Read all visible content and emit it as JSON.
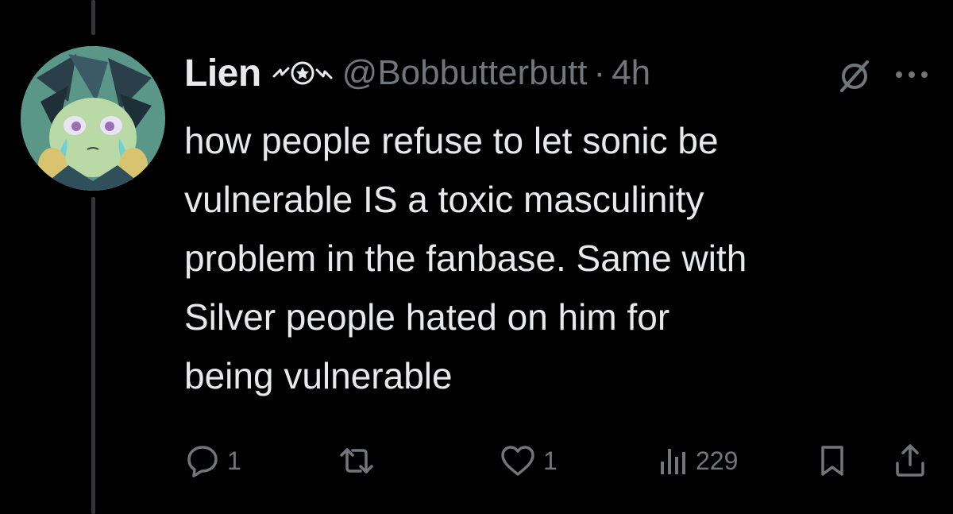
{
  "tweet": {
    "display_name": "Lien",
    "handle": "@Bobbutterbutt",
    "separator": "·",
    "time": "4h",
    "text_lines": [
      "how people refuse to let sonic be",
      "vulnerable IS a toxic masculinity",
      "problem in the fanbase. Same with",
      "Silver people hated on him for",
      "being vulnerable"
    ]
  },
  "actions": {
    "reply_count": "1",
    "repost_count": "",
    "like_count": "1",
    "views_count": "229"
  },
  "icons": {
    "name_emoji": "lightning-star-icon",
    "grok": "grok-icon",
    "more": "more-icon",
    "reply": "reply-icon",
    "repost": "repost-icon",
    "like": "heart-icon",
    "views": "views-icon",
    "bookmark": "bookmark-icon",
    "share": "share-icon"
  },
  "colors": {
    "background": "#000000",
    "primary_text": "#e7e9ea",
    "secondary_text": "#71767b",
    "thread_line": "#333639"
  }
}
